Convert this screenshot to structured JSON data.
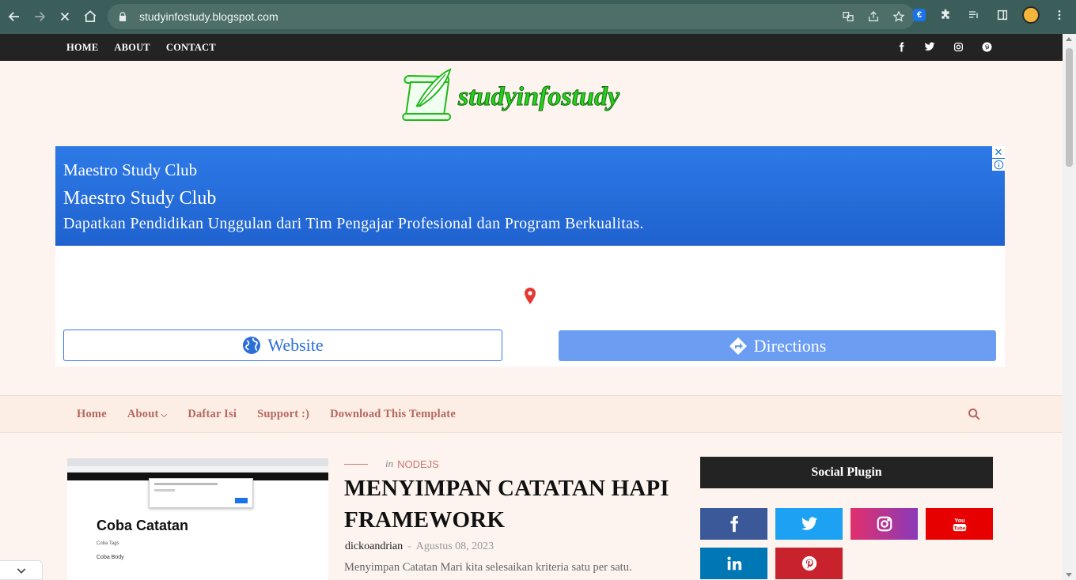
{
  "browser": {
    "url": "studyinfostudy.blogspot.com"
  },
  "topnav": {
    "items": [
      "HOME",
      "ABOUT",
      "CONTACT"
    ]
  },
  "logo": {
    "text": "studyinfostudy"
  },
  "ad": {
    "small_title": "Maestro Study Club",
    "title": "Maestro Study Club",
    "description": "Dapatkan Pendidikan Unggulan dari Tim Pengajar Profesional dan Program Berkualitas.",
    "website_label": "Website",
    "directions_label": "Directions",
    "colors": {
      "banner": "#2d7ae6",
      "directions": "#6b9ef3"
    }
  },
  "menu": {
    "items": [
      "Home",
      "About",
      "Daftar Isi",
      "Support :)",
      "Download This Template"
    ],
    "color": "#b4675f"
  },
  "post": {
    "in_label": "in",
    "category": "NODEJS",
    "title": "MENYIMPAN CATATAN HAPI FRAMEWORK",
    "author": "dickoandrian",
    "separator": "-",
    "date": "Agustus 08, 2023",
    "excerpt": "Menyimpan Catatan Mari kita selesaikan kriteria satu per satu.",
    "thumbnail": {
      "title": "Coba Catatan",
      "tags": "Coba Tags",
      "body": "Coba Body"
    }
  },
  "sidebar": {
    "widget_title": "Social Plugin",
    "social": [
      {
        "icon": "facebook-icon",
        "color": "#3b5998"
      },
      {
        "icon": "twitter-icon",
        "color": "#1da1f2"
      },
      {
        "icon": "instagram-icon",
        "color": "#c13584"
      },
      {
        "icon": "youtube-icon",
        "color": "#e60000"
      },
      {
        "icon": "linkedin-icon",
        "color": "#0077b5"
      },
      {
        "icon": "pinterest-icon",
        "color": "#c8232c"
      }
    ]
  }
}
